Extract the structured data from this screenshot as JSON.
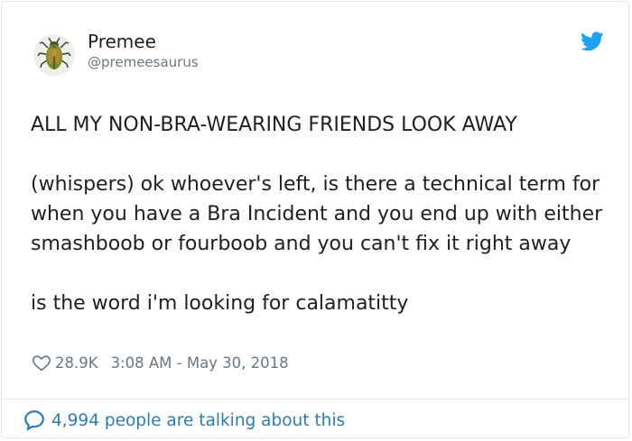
{
  "author": {
    "display_name": "Premee",
    "handle": "@premeesaurus",
    "avatar_icon": "beetle-avatar-icon"
  },
  "brand": {
    "icon": "twitter-bird-icon",
    "color": "#1da1f2"
  },
  "tweet": {
    "paragraphs": [
      "ALL MY NON-BRA-WEARING FRIENDS LOOK AWAY",
      "(whispers) ok whoever's left, is there a technical term for when you have a Bra Incident and you end up with either smashboob or fourboob and you can't fix it right away",
      "is the word i'm looking for calamatitty"
    ]
  },
  "meta": {
    "likes": "28.9K",
    "timestamp": "3:08 AM - May 30, 2018",
    "like_icon": "heart-icon"
  },
  "footer": {
    "talking_text": "4,994 people are talking about this",
    "icon": "speech-bubble-icon"
  },
  "colors": {
    "text": "#1c2022",
    "muted": "#697882",
    "link": "#2b7bb9",
    "border": "#e1e8ed"
  }
}
